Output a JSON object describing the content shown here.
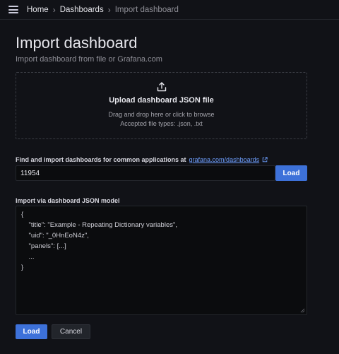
{
  "breadcrumb": {
    "items": [
      "Home",
      "Dashboards"
    ],
    "current": "Import dashboard",
    "separator": "›"
  },
  "page": {
    "title": "Import dashboard",
    "subtitle": "Import dashboard from file or Grafana.com"
  },
  "upload": {
    "title": "Upload dashboard JSON file",
    "hint": "Drag and drop here or click to browse",
    "types": "Accepted file types: .json, .txt",
    "icon": "upload-icon"
  },
  "find": {
    "label": "Find and import dashboards for common applications at",
    "link_text": "grafana.com/dashboards",
    "input_value": "11954",
    "load_label": "Load"
  },
  "json_model": {
    "label": "Import via dashboard JSON model",
    "lines": [
      "{",
      "    \"title\": \"Example - Repeating Dictionary variables\",",
      "    \"uid\": \"_0HnEoN4z\",",
      "    \"panels\": [...]",
      "    ...",
      "}"
    ]
  },
  "actions": {
    "load_label": "Load",
    "cancel_label": "Cancel"
  },
  "colors": {
    "background": "#111217",
    "primary": "#3d71d9",
    "link": "#6e9fff"
  }
}
